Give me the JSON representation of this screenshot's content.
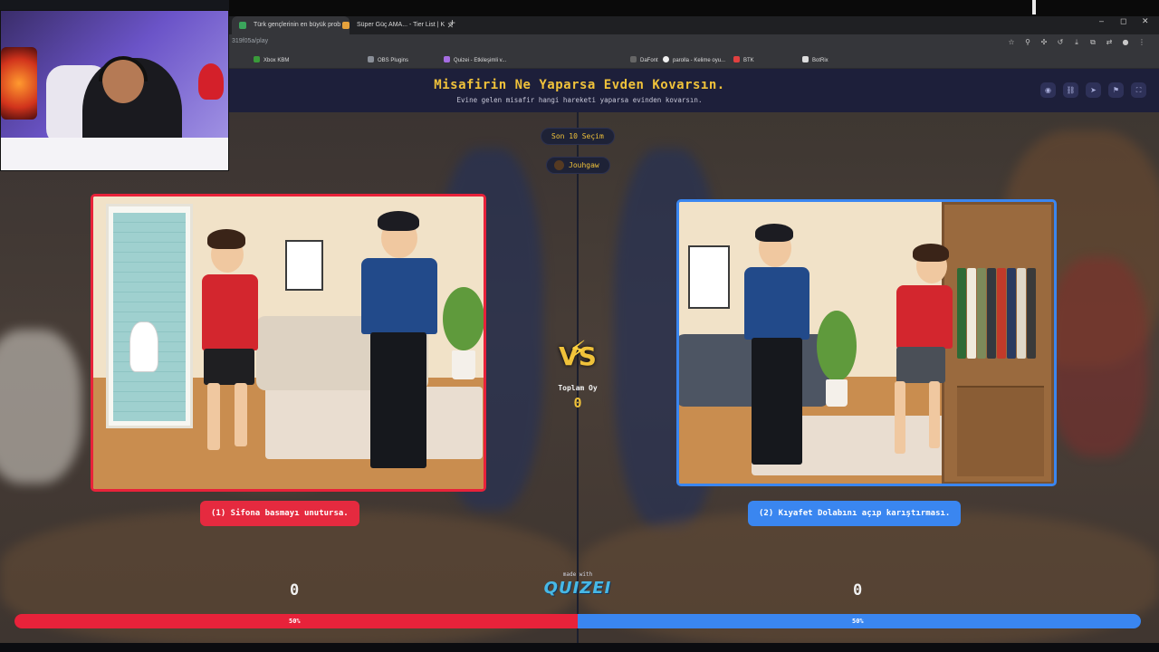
{
  "browser": {
    "tabs": [
      {
        "title": "Türk gençlerinin en büyük prob"
      },
      {
        "title": "Süper Güç AMA... - Tier List | K"
      }
    ],
    "new_tab": "+",
    "url": "319f05a/play",
    "window_controls": {
      "minimize": "–",
      "maximize": "◻",
      "close": "✕"
    },
    "bookmarks": [
      {
        "label": "Xbox KBM",
        "color": "#3a9b3a"
      },
      {
        "label": "OBS Plugins",
        "color": "#8a8f98"
      },
      {
        "label": "Quizei - Etkileşimli v...",
        "color": "#a56de2"
      },
      {
        "label": "DaFont",
        "color": "#666666"
      },
      {
        "label": "parolla - Kelime oyu...",
        "color": "#f0f0f0"
      },
      {
        "label": "BTK",
        "color": "#e04040"
      },
      {
        "label": "BotRix",
        "color": "#dddddd"
      }
    ]
  },
  "quiz": {
    "title": "Misafirin Ne Yaparsa Evden Kovarsın.",
    "subtitle": "Evine gelen misafir hangi hareketi yaparsa evinden kovarsın.",
    "round_label": "Son 10 Seçim",
    "user_name": "Jouhgaw",
    "total_label": "Toplam Oy",
    "total_value": "0",
    "vs_label": "VS",
    "made_with": "made with",
    "logo_text": "QUIZEI",
    "accent_color": "#f0c23a",
    "options": [
      {
        "label": "(1) Sifona basmayı unutursa.",
        "score": "0",
        "percent": "50%",
        "share": 0.5,
        "color": "#e8223a"
      },
      {
        "label": "(2) Kıyafet Dolabını açıp karıştırması.",
        "score": "0",
        "percent": "50%",
        "share": 0.5,
        "color": "#3a86f0"
      }
    ],
    "header_icons": [
      "eye-icon",
      "link-icon",
      "send-icon",
      "flag-icon",
      "fullscreen-icon"
    ]
  }
}
